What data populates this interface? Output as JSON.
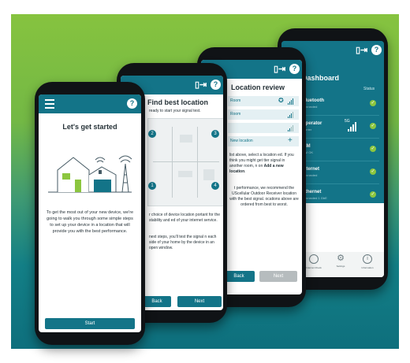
{
  "screen1": {
    "title": "Let's get started",
    "body": "To get the most out of your new device, we're going to walk you through some simple steps to set up your device in a location that will provide you with the best performance.",
    "start_label": "Start",
    "help": "?"
  },
  "screen2": {
    "title": "Find best location",
    "subtitle": "ready to start your signal test.",
    "room_numbers": [
      "2",
      "3",
      "1",
      "4"
    ],
    "body1": "r choice of device location portant for the stability and ed of your internet service.",
    "body2": "next steps, you'll test the signal n each side of your home by the device in an open window.",
    "back_label": "Back",
    "next_label": "Next",
    "help": "?"
  },
  "screen3": {
    "title": "Location review",
    "rows": [
      "Room",
      "Room",
      "",
      "New location"
    ],
    "body1_pre": "list above, select a location ed. If you think you might get tter signal in another room, n on ",
    "body1_strong": "Add a new location",
    "body1_post": ".",
    "body2": "t performance, we recommend the UScellular Outdoor Receiver location with the best signal. ocations above are ordered from best to worst.",
    "back_label": "Back",
    "next_label": "Next",
    "help": "?"
  },
  "screen4": {
    "title": "Dashboard",
    "status_label": "Status",
    "items": [
      {
        "name": "Bluetooth",
        "sub": "Connected"
      },
      {
        "name": "Operator",
        "sub": "Carrier"
      },
      {
        "name": "SIM",
        "sub": "SIM OK"
      },
      {
        "name": "Internet",
        "sub": "Connected"
      },
      {
        "name": "Ethernet",
        "sub": "Connected 1 GbE"
      }
    ],
    "signal_label": "5G",
    "nav": [
      "Internet Check",
      "Settings",
      "Information"
    ],
    "help": "?"
  },
  "colors": {
    "teal": "#137488",
    "green": "#8cc63f",
    "dark_teal": "#0e6f7d"
  }
}
